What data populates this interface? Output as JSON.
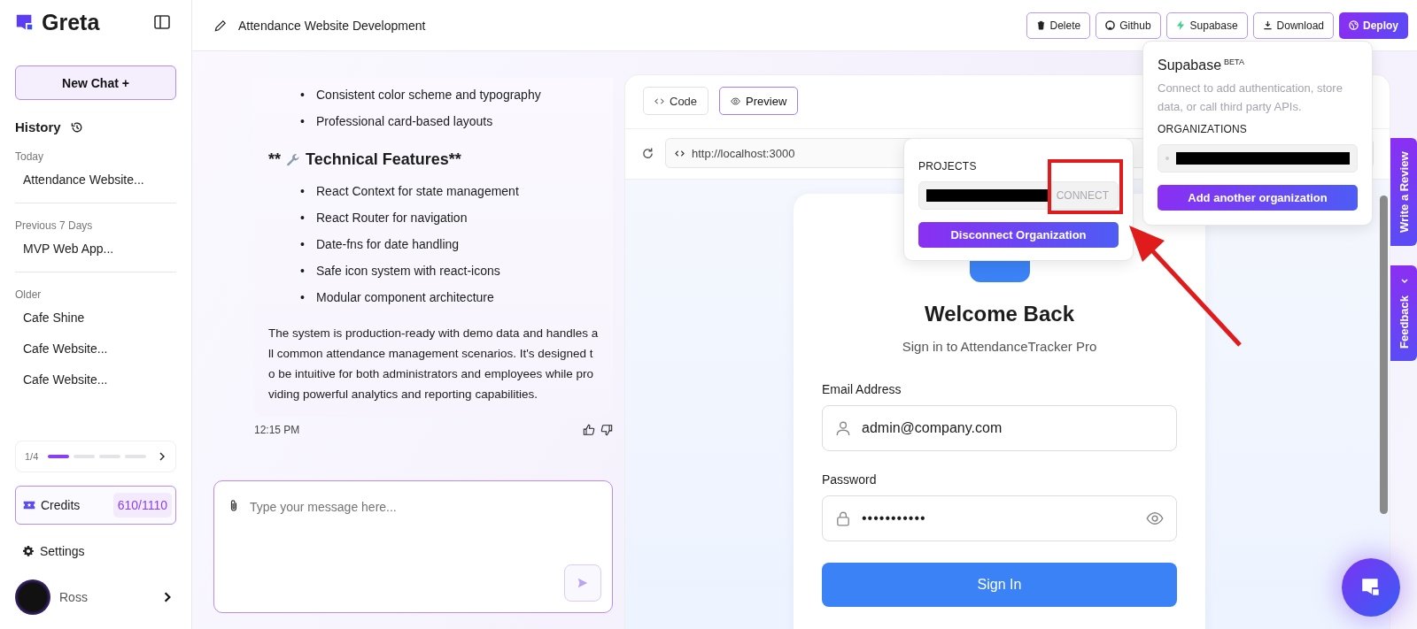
{
  "sidebar": {
    "brand": "Greta",
    "new_chat": "New Chat +",
    "history_title": "History",
    "groups": [
      {
        "label": "Today",
        "items": [
          "Attendance Website..."
        ]
      },
      {
        "label": "Previous 7 Days",
        "items": [
          "MVP Web App..."
        ]
      },
      {
        "label": "Older",
        "items": [
          "Cafe Shine",
          "Cafe Website...",
          "Cafe Website..."
        ]
      }
    ],
    "pager": {
      "label": "1/4",
      "pages": [
        {
          "selected": true
        },
        {
          "selected": false
        },
        {
          "selected": false
        },
        {
          "selected": false
        }
      ]
    },
    "credits": {
      "label": "Credits",
      "value": "610/1110"
    },
    "settings": "Settings",
    "user": "Ross"
  },
  "header": {
    "title": "Attendance Website Development",
    "buttons": [
      {
        "label": "Delete",
        "kind": "trash"
      },
      {
        "label": "Github",
        "kind": "github"
      },
      {
        "label": "Supabase",
        "kind": "bolt"
      },
      {
        "label": "Download",
        "kind": "download"
      },
      {
        "label": "Deploy",
        "kind": "deploy"
      }
    ]
  },
  "chat": {
    "bullet": "•",
    "bullets_top": [
      "Consistent color scheme and typography",
      "Professional card-based layouts"
    ],
    "heading": {
      "prefix": "**",
      "text": "Technical Features**"
    },
    "bullets": [
      "React Context for state management",
      "React Router for navigation",
      "Date-fns for date handling",
      "Safe icon system with react-icons",
      "Modular component architecture"
    ],
    "paragraph": "The system is production-ready with demo data and handles all common attendance management scenarios. It's designed to be intuitive for both administrators and employees while providing powerful analytics and reporting capabilities.",
    "time": "12:15 PM",
    "input": {
      "placeholder": "Type your message here..."
    }
  },
  "preview": {
    "tabs": [
      {
        "label": "Code",
        "selected": false
      },
      {
        "label": "Preview",
        "selected": true
      }
    ],
    "url": "http://localhost:3000",
    "login": {
      "title": "Welcome Back",
      "subtitle": "Sign in to AttendanceTracker Pro",
      "email_label": "Email Address",
      "email_value": "admin@company.com",
      "password_label": "Password",
      "password_value": "•••••••••••",
      "submit": "Sign In"
    }
  },
  "supabase_popover": {
    "title": "Supabase",
    "badge": "BETA",
    "description": "Connect to add authentication, store data, or call third party APIs.",
    "section": "ORGANIZATIONS",
    "button": "Add another organization"
  },
  "projects_popover": {
    "section": "PROJECTS",
    "connect": {
      "label": "CONNECT",
      "disabled": true
    },
    "button": "Disconnect Organization"
  },
  "side_tabs": [
    "Write a Review",
    "Feedback"
  ]
}
